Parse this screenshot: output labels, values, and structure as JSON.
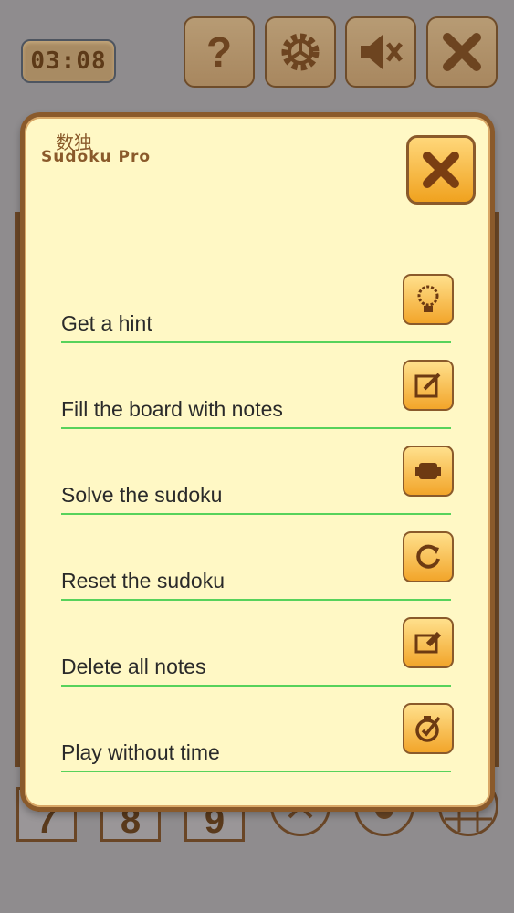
{
  "topbar": {
    "timer": "03:08",
    "help_label": "?",
    "settings_icon": "gear-icon",
    "sound_icon": "speaker-muted-icon",
    "exit_icon": "close-icon"
  },
  "keypad": {
    "numbers": [
      "7",
      "8",
      "9"
    ]
  },
  "dialog": {
    "logo_cn": "数独",
    "logo_en": "Sudoku Pro",
    "close_icon": "close-icon",
    "items": [
      {
        "label": "Get a hint",
        "icon": "lightbulb-icon"
      },
      {
        "label": "Fill the board with notes",
        "icon": "pencil-note-icon"
      },
      {
        "label": "Solve the sudoku",
        "icon": "solve-icon"
      },
      {
        "label": "Reset the sudoku",
        "icon": "reset-icon"
      },
      {
        "label": "Delete all notes",
        "icon": "eraser-icon"
      },
      {
        "label": "Play without time",
        "icon": "stopwatch-icon"
      }
    ]
  },
  "colors": {
    "background": "#8f8c8e",
    "dialog_bg": "#fff8c5",
    "dialog_border": "#8a5a2b",
    "button_orange": "#f2a52a",
    "separator_green": "#57d25b"
  }
}
